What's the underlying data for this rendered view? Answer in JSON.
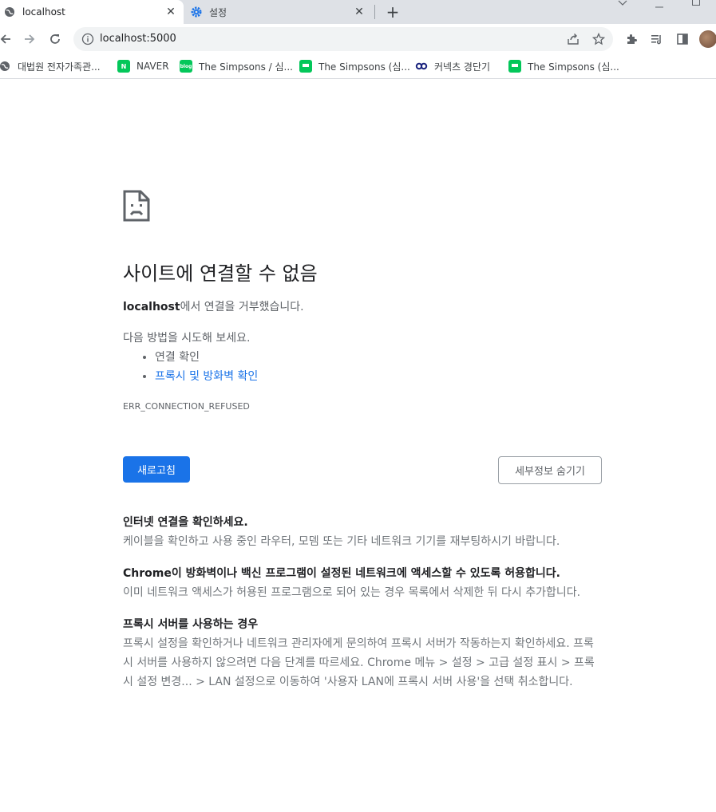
{
  "tabs": [
    {
      "title": "localhost",
      "icon": "globe-icon"
    },
    {
      "title": "설정",
      "icon": "gear-icon"
    }
  ],
  "toolbar": {
    "url": "localhost:5000"
  },
  "bookmarks": [
    {
      "label": "대법원 전자가족관...",
      "icon": "globe-icon"
    },
    {
      "label": "NAVER",
      "icon": "naver-icon",
      "color": "#03c75a"
    },
    {
      "label": "The Simpsons / 심...",
      "icon": "blog-icon",
      "color": "#03c75a"
    },
    {
      "label": "The Simpsons (심...",
      "icon": "naver-talk-icon",
      "color": "#03c75a"
    },
    {
      "label": "커넥츠 경단기",
      "icon": "connects-icon",
      "color": "#1a237e"
    },
    {
      "label": "The Simpsons (심...",
      "icon": "naver-talk-icon",
      "color": "#03c75a"
    }
  ],
  "error": {
    "title": "사이트에 연결할 수 없음",
    "host": "localhost",
    "desc_suffix": "에서 연결을 거부했습니다.",
    "try_label": "다음 방법을 시도해 보세요.",
    "suggestion_1": "연결 확인",
    "suggestion_2": "프록시 및 방화벽 확인",
    "code": "ERR_CONNECTION_REFUSED",
    "reload_label": "새로고침",
    "details_label": "세부정보 숨기기"
  },
  "details": [
    {
      "head": "인터넷 연결을 확인하세요.",
      "body": "케이블을 확인하고 사용 중인 라우터, 모뎀 또는 기타 네트워크 기기를 재부팅하시기 바랍니다."
    },
    {
      "head": "Chrome이 방화벽이나 백신 프로그램이 설정된 네트워크에 액세스할 수 있도록 허용합니다.",
      "body": "이미 네트워크 액세스가 허용된 프로그램으로 되어 있는 경우 목록에서 삭제한 뒤 다시 추가합니다."
    },
    {
      "head": "프록시 서버를 사용하는 경우",
      "body": "프록시 설정을 확인하거나 네트워크 관리자에게 문의하여 프록시 서버가 작동하는지 확인하세요. 프록시 서버를 사용하지 않으려면 다음 단계를 따르세요. Chrome 메뉴 > 설정 > 고급 설정 표시 > 프록시 설정 변경... > LAN 설정으로 이동하여 '사용자 LAN에 프록시 서버 사용'을 선택 취소합니다."
    }
  ],
  "colors": {
    "accent": "#1a73e8",
    "tabstrip": "#dee1e6"
  }
}
